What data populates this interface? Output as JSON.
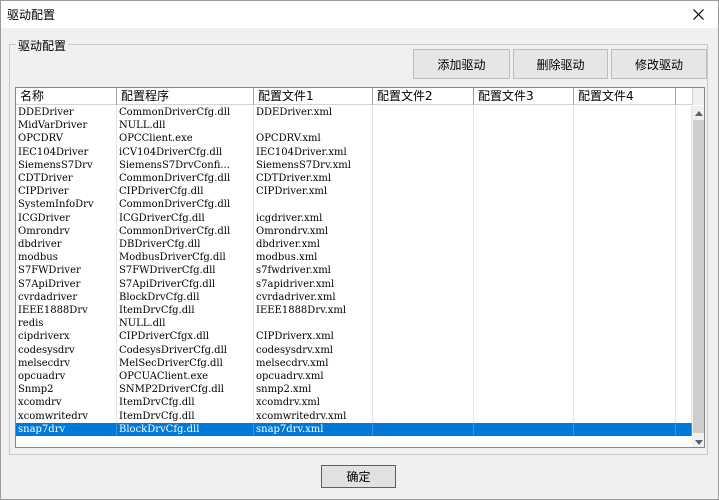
{
  "window": {
    "title": "驱动配置"
  },
  "group": {
    "legend": "驱动配置"
  },
  "toolbar": {
    "add_label": "添加驱动",
    "delete_label": "删除驱动",
    "edit_label": "修改驱动"
  },
  "table": {
    "columns": [
      "名称",
      "配置程序",
      "配置文件1",
      "配置文件2",
      "配置文件3",
      "配置文件4"
    ],
    "rows": [
      [
        "DDEDriver",
        "CommonDriverCfg.dll",
        "DDEDriver.xml",
        "",
        "",
        ""
      ],
      [
        "MidVarDriver",
        "NULL.dll",
        "",
        "",
        "",
        ""
      ],
      [
        "OPCDRV",
        "OPCClient.exe",
        "OPCDRV.xml",
        "",
        "",
        ""
      ],
      [
        "IEC104Driver",
        "iCV104DriverCfg.dll",
        "IEC104Driver.xml",
        "",
        "",
        ""
      ],
      [
        "SiemensS7Drv",
        "SiemensS7DrvConfi...",
        "SiemensS7Drv.xml",
        "",
        "",
        ""
      ],
      [
        "CDTDriver",
        "CommonDriverCfg.dll",
        "CDTDriver.xml",
        "",
        "",
        ""
      ],
      [
        "CIPDriver",
        "CIPDriverCfg.dll",
        "CIPDriver.xml",
        "",
        "",
        ""
      ],
      [
        "SystemInfoDrv",
        "CommonDriverCfg.dll",
        "",
        "",
        "",
        ""
      ],
      [
        "ICGDriver",
        "ICGDriverCfg.dll",
        "icgdriver.xml",
        "",
        "",
        ""
      ],
      [
        "Omrondrv",
        "CommonDriverCfg.dll",
        "Omrondrv.xml",
        "",
        "",
        ""
      ],
      [
        "dbdriver",
        "DBDriverCfg.dll",
        "dbdriver.xml",
        "",
        "",
        ""
      ],
      [
        "modbus",
        "ModbusDriverCfg.dll",
        "modbus.xml",
        "",
        "",
        ""
      ],
      [
        "S7FWDriver",
        "S7FWDriverCfg.dll",
        "s7fwdriver.xml",
        "",
        "",
        ""
      ],
      [
        "S7ApiDriver",
        "S7ApiDriverCfg.dll",
        "s7apidriver.xml",
        "",
        "",
        ""
      ],
      [
        "cvrdadriver",
        "BlockDrvCfg.dll",
        "cvrdadriver.xml",
        "",
        "",
        ""
      ],
      [
        "IEEE1888Drv",
        "ItemDrvCfg.dll",
        "IEEE1888Drv.xml",
        "",
        "",
        ""
      ],
      [
        "redis",
        "NULL.dll",
        "",
        "",
        "",
        ""
      ],
      [
        "cipdriverx",
        "CIPDriverCfgx.dll",
        "CIPDriverx.xml",
        "",
        "",
        ""
      ],
      [
        "codesysdrv",
        "CodesysDriverCfg.dll",
        "codesysdrv.xml",
        "",
        "",
        ""
      ],
      [
        "melsecdrv",
        "MelSecDriverCfg.dll",
        "melsecdrv.xml",
        "",
        "",
        ""
      ],
      [
        "opcuadrv",
        "OPCUAClient.exe",
        "opcuadrv.xml",
        "",
        "",
        ""
      ],
      [
        "Snmp2",
        "SNMP2DriverCfg.dll",
        "snmp2.xml",
        "",
        "",
        ""
      ],
      [
        "xcomdrv",
        "ItemDrvCfg.dll",
        "xcomdrv.xml",
        "",
        "",
        ""
      ],
      [
        "xcomwritedrv",
        "ItemDrvCfg.dll",
        "xcomwritedrv.xml",
        "",
        "",
        ""
      ],
      [
        "snap7drv",
        "BlockDrvCfg.dll",
        "snap7drv.xml",
        "",
        "",
        ""
      ]
    ],
    "selected_row": 24
  },
  "footer": {
    "ok_label": "确定"
  },
  "colors": {
    "selection": "#0078d7",
    "selection_text": "#ffffff"
  },
  "icons": {
    "close": "close-icon",
    "scroll_up": "scroll-up-icon",
    "scroll_down": "scroll-down-icon"
  }
}
